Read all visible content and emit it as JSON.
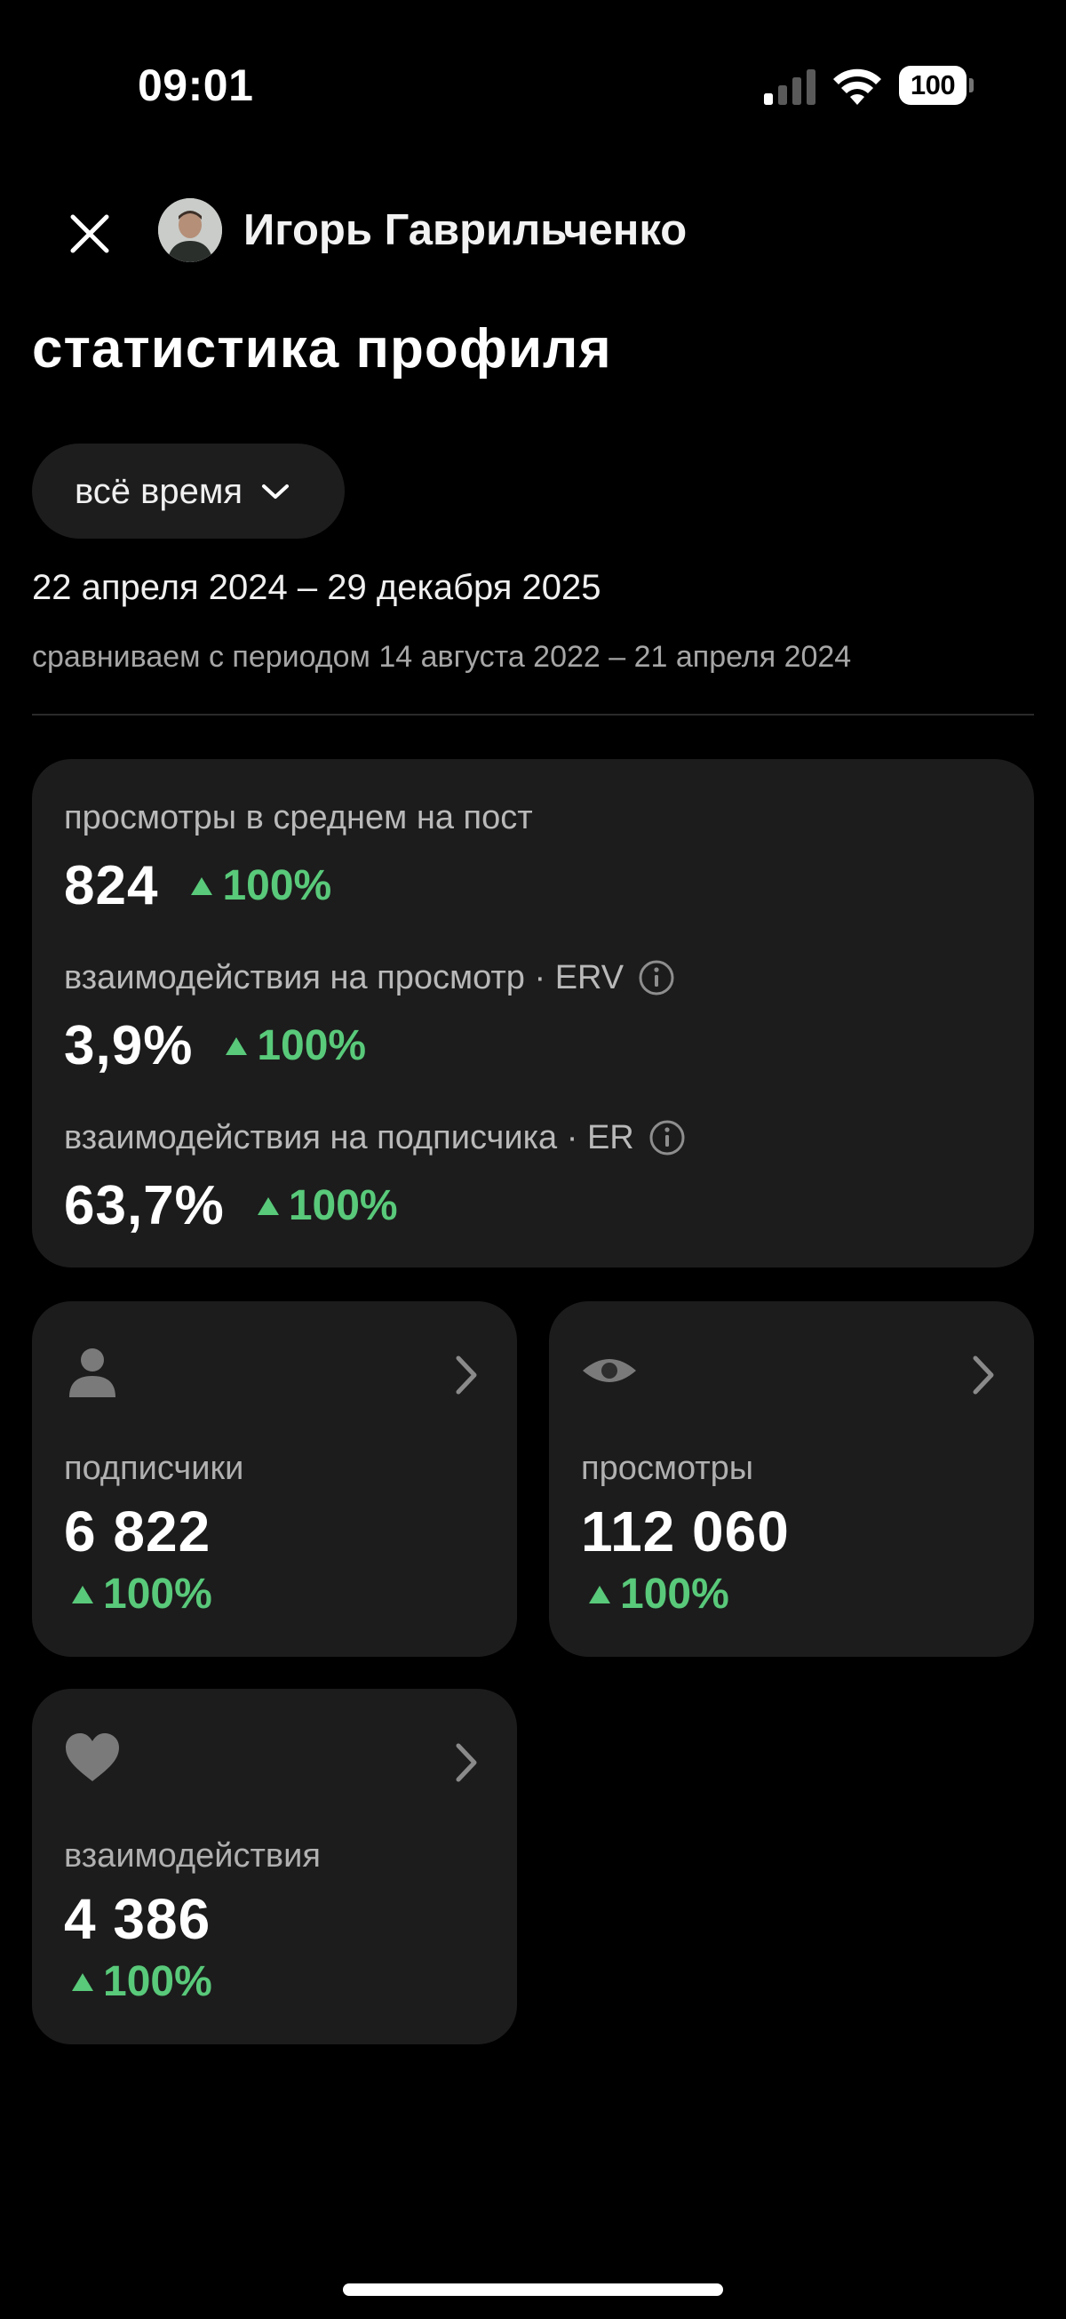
{
  "status_bar": {
    "time": "09:01",
    "battery": "100"
  },
  "header": {
    "profile_name": "Игорь Гаврильченко",
    "title": "статистика профиля"
  },
  "period": {
    "selected": "всё время",
    "range": "22 апреля 2024 – 29 декабря 2025",
    "compare": "сравниваем с периодом 14 августа 2022 – 21 апреля 2024"
  },
  "metrics": [
    {
      "label": "просмотры в среднем на пост",
      "value": "824",
      "delta": "100%"
    },
    {
      "label": "взаимодействия на просмотр · ERV",
      "value": "3,9%",
      "delta": "100%"
    },
    {
      "label": "взаимодействия на подписчика · ER",
      "value": "63,7%",
      "delta": "100%"
    }
  ],
  "cards": {
    "subscribers": {
      "icon": "person-icon",
      "label": "подписчики",
      "value": "6 822",
      "delta": "100%"
    },
    "views": {
      "icon": "eye-icon",
      "label": "просмотры",
      "value": "112 060",
      "delta": "100%"
    },
    "interactions": {
      "icon": "heart-icon",
      "label": "взаимодействия",
      "value": "4 386",
      "delta": "100%"
    }
  },
  "colors": {
    "background": "#000000",
    "card": "#1c1c1c",
    "positive": "#59c97a",
    "muted_text": "#a6a6a6",
    "icon_gray": "#7a7a7a"
  }
}
